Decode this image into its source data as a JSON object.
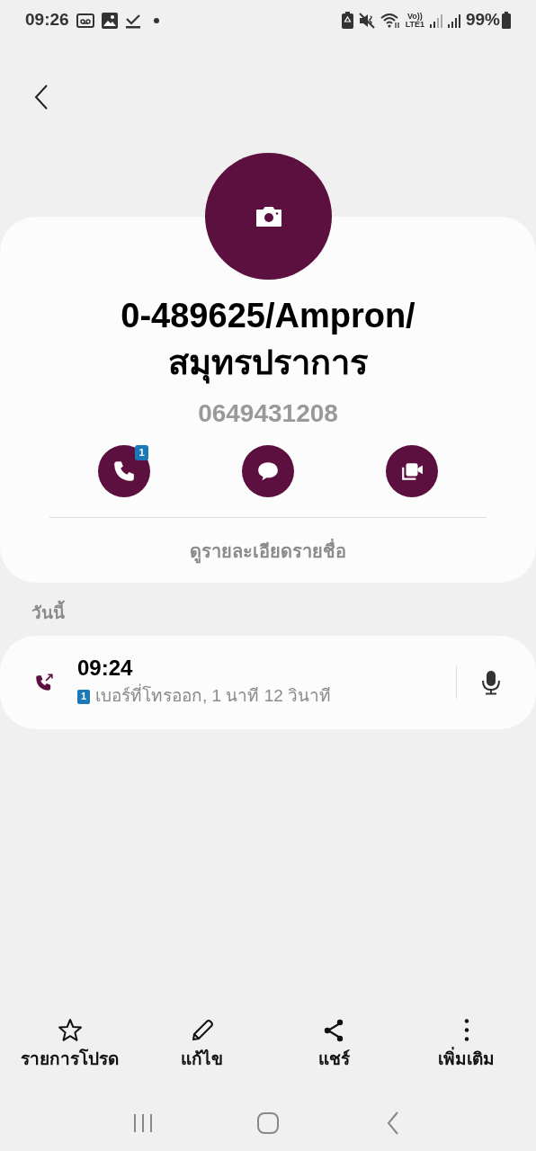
{
  "status_bar": {
    "time": "09:26",
    "volte": "Vo))",
    "network": "LTE1",
    "battery": "99%"
  },
  "contact": {
    "name_lines": [
      "0-489625/Ampron/",
      "สมุทรปราการ"
    ],
    "number": "0649431208"
  },
  "actions": [
    {
      "kind": "call",
      "badge": "1"
    },
    {
      "kind": "message"
    },
    {
      "kind": "video"
    }
  ],
  "details_link": "ดูรายละเอียดรายชื่อ",
  "log": {
    "section": "วันนี้",
    "entries": [
      {
        "kind": "outgoing",
        "time": "09:24",
        "sim": "1",
        "description": "เบอร์ที่โทรออก, 1 นาที 12 วินาที"
      }
    ]
  },
  "bottom_bar": [
    {
      "kind": "favorite",
      "label": "รายการโปรด"
    },
    {
      "kind": "edit",
      "label": "แก้ไข"
    },
    {
      "kind": "share",
      "label": "แชร์"
    },
    {
      "kind": "more",
      "label": "เพิ่มเติม"
    }
  ]
}
